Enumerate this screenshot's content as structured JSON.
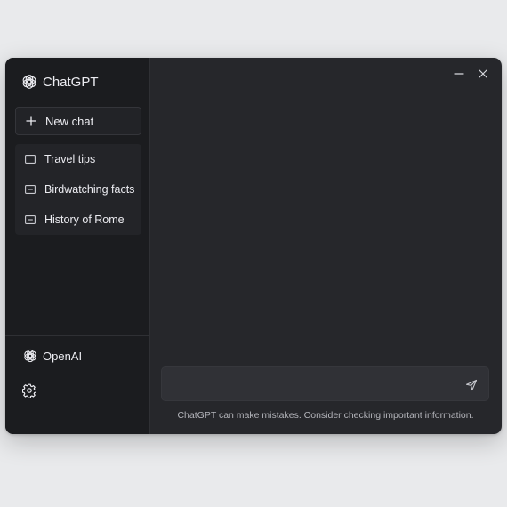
{
  "app": {
    "title": "ChatGPT"
  },
  "sidebar": {
    "new_chat_label": "New chat",
    "history": [
      {
        "label": "Travel tips"
      },
      {
        "label": "Birdwatching facts"
      },
      {
        "label": "History of Rome"
      }
    ],
    "org_name": "OpenAI"
  },
  "composer": {
    "placeholder": ""
  },
  "footer": {
    "disclaimer": "ChatGPT can make mistakes. Consider checking important information."
  },
  "icons": {
    "brand": "openai-logo-icon",
    "new_chat": "plus-icon",
    "chat": "chat-bubble-icon",
    "settings": "gear-icon",
    "minimize": "minimize-icon",
    "close": "close-icon",
    "send": "send-icon"
  },
  "colors": {
    "window_bg": "#26272b",
    "sidebar_bg": "#1b1c1f",
    "text": "#ececf1",
    "muted_text": "#b4b5bb"
  }
}
